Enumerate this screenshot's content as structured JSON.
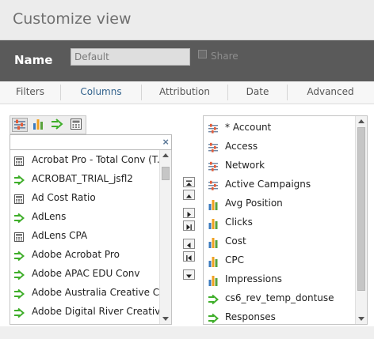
{
  "dialog": {
    "title": "Customize view"
  },
  "name_bar": {
    "label": "Name",
    "value": "Default",
    "share_label": "Share",
    "share_checked": false
  },
  "tabs": [
    {
      "label": "Filters",
      "active": false
    },
    {
      "label": "Columns",
      "active": true
    },
    {
      "label": "Attribution",
      "active": false
    },
    {
      "label": "Date",
      "active": false
    },
    {
      "label": "Advanced",
      "active": false
    }
  ],
  "toolbar": {
    "icons": [
      "attributes-icon",
      "metrics-icon",
      "conversions-icon",
      "calculated-icon"
    ]
  },
  "search": {
    "value": "",
    "clear_symbol": "×"
  },
  "available_columns": [
    {
      "label": "Acrobat Pro - Total Conv (T...",
      "icon": "calculator-icon"
    },
    {
      "label": "ACROBAT_TRIAL_jsfl2",
      "icon": "conversion-arrow-icon"
    },
    {
      "label": "Ad Cost Ratio",
      "icon": "calculator-icon"
    },
    {
      "label": "AdLens",
      "icon": "conversion-arrow-icon"
    },
    {
      "label": "AdLens CPA",
      "icon": "calculator-icon"
    },
    {
      "label": "Adobe Acrobat Pro",
      "icon": "conversion-arrow-icon"
    },
    {
      "label": "Adobe APAC EDU Conv",
      "icon": "conversion-arrow-icon"
    },
    {
      "label": "Adobe Australia Creative Cl...",
      "icon": "conversion-arrow-icon"
    },
    {
      "label": "Adobe Digital River Creative...",
      "icon": "conversion-arrow-icon"
    }
  ],
  "selected_columns": [
    {
      "label": "* Account",
      "icon": "attribute-icon"
    },
    {
      "label": "Access",
      "icon": "attribute-icon"
    },
    {
      "label": "Network",
      "icon": "attribute-icon"
    },
    {
      "label": "Active Campaigns",
      "icon": "attribute-icon"
    },
    {
      "label": "Avg Position",
      "icon": "metric-bars-icon"
    },
    {
      "label": "Clicks",
      "icon": "metric-bars-icon"
    },
    {
      "label": "Cost",
      "icon": "metric-bars-icon"
    },
    {
      "label": "CPC",
      "icon": "metric-bars-icon"
    },
    {
      "label": "Impressions",
      "icon": "metric-bars-icon"
    },
    {
      "label": "cs6_rev_temp_dontuse",
      "icon": "conversion-arrow-icon"
    },
    {
      "label": "Responses",
      "icon": "conversion-arrow-icon"
    }
  ],
  "move_buttons": [
    "move-top-button",
    "move-up-button",
    "add-button",
    "add-all-button",
    "remove-button",
    "remove-all-button",
    "move-down-button"
  ],
  "colors": {
    "accent": "#32628c",
    "name_bar": "#5a5a5a",
    "arrow_green": "#3fae2a"
  }
}
